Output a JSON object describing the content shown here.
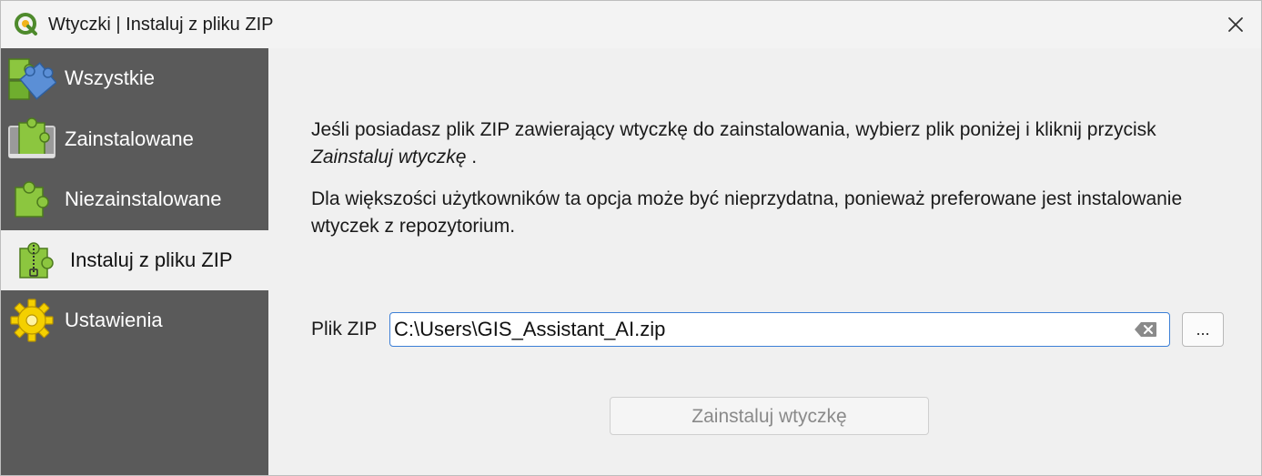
{
  "window": {
    "title": "Wtyczki | Instaluj z pliku ZIP",
    "app_icon": "qgis-logo-icon",
    "close_icon": "close-icon"
  },
  "sidebar": {
    "items": [
      {
        "label": "Wszystkie",
        "icon": "puzzle-all-icon",
        "active": false
      },
      {
        "label": "Zainstalowane",
        "icon": "puzzle-installed-icon",
        "active": false
      },
      {
        "label": "Niezainstalowane",
        "icon": "puzzle-not-installed-icon",
        "active": false
      },
      {
        "label": "Instaluj z pliku ZIP",
        "icon": "puzzle-zip-icon",
        "active": true
      },
      {
        "label": "Ustawienia",
        "icon": "gear-icon",
        "active": false
      }
    ]
  },
  "main": {
    "intro_text": "Jeśli posiadasz plik ZIP zawierający wtyczkę do zainstalowania, wybierz plik poniżej i kliknij przycisk",
    "intro_action": "Zainstaluj wtyczkę",
    "intro_end": " .",
    "note_text": "Dla większości użytkowników ta opcja może być nieprzydatna, ponieważ preferowane jest instalowanie wtyczek z repozytorium.",
    "zip_label": "Plik ZIP",
    "zip_value": "C:\\Users\\GIS_Assistant_AI.zip",
    "browse_label": "...",
    "install_label": "Zainstaluj wtyczkę"
  },
  "colors": {
    "sidebar_bg": "#5a5a5a",
    "content_bg": "#f0f0f0",
    "field_focus": "#3c7fd6",
    "puzzle_green": "#8cc63f",
    "puzzle_blue": "#5b8fd6",
    "gear_yellow": "#f4d000"
  }
}
